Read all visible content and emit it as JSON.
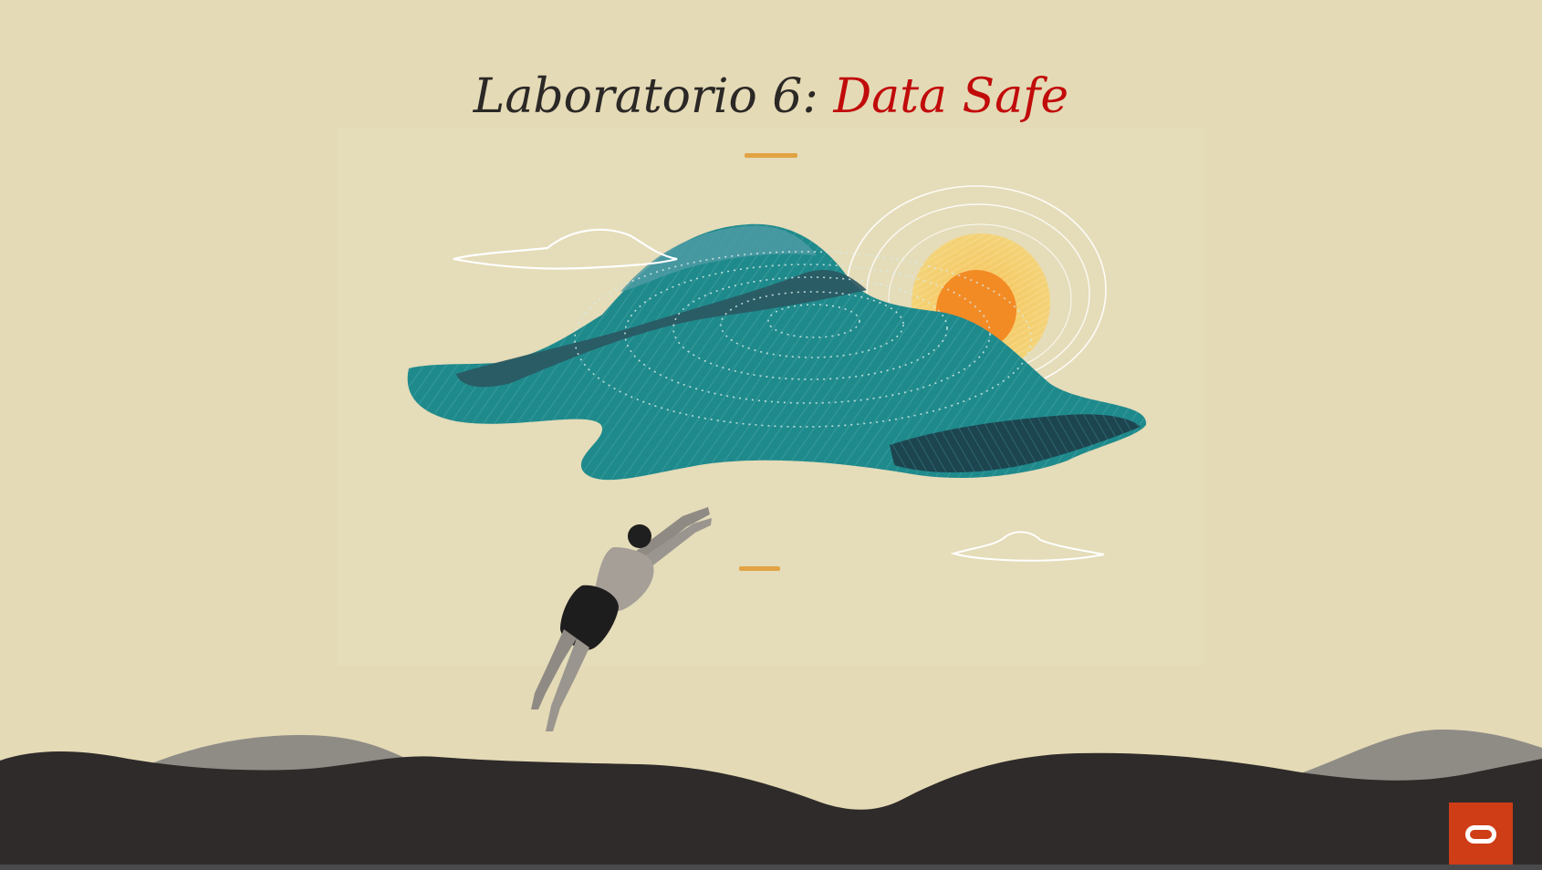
{
  "slide": {
    "title_main": "Laboratorio 6: ",
    "title_accent": "Data Safe"
  },
  "illustration": {
    "subject": "island-swimmer-illustration"
  },
  "logo": {
    "brand": "oracle-logo",
    "color": "#cf3d17"
  },
  "colors": {
    "background": "#e4dab6",
    "title_text": "#2b2826",
    "title_accent": "#c10b0b",
    "divider": "#e2a344",
    "hills_dark": "#2f2b2a",
    "hills_grey": "#8f8c86"
  }
}
